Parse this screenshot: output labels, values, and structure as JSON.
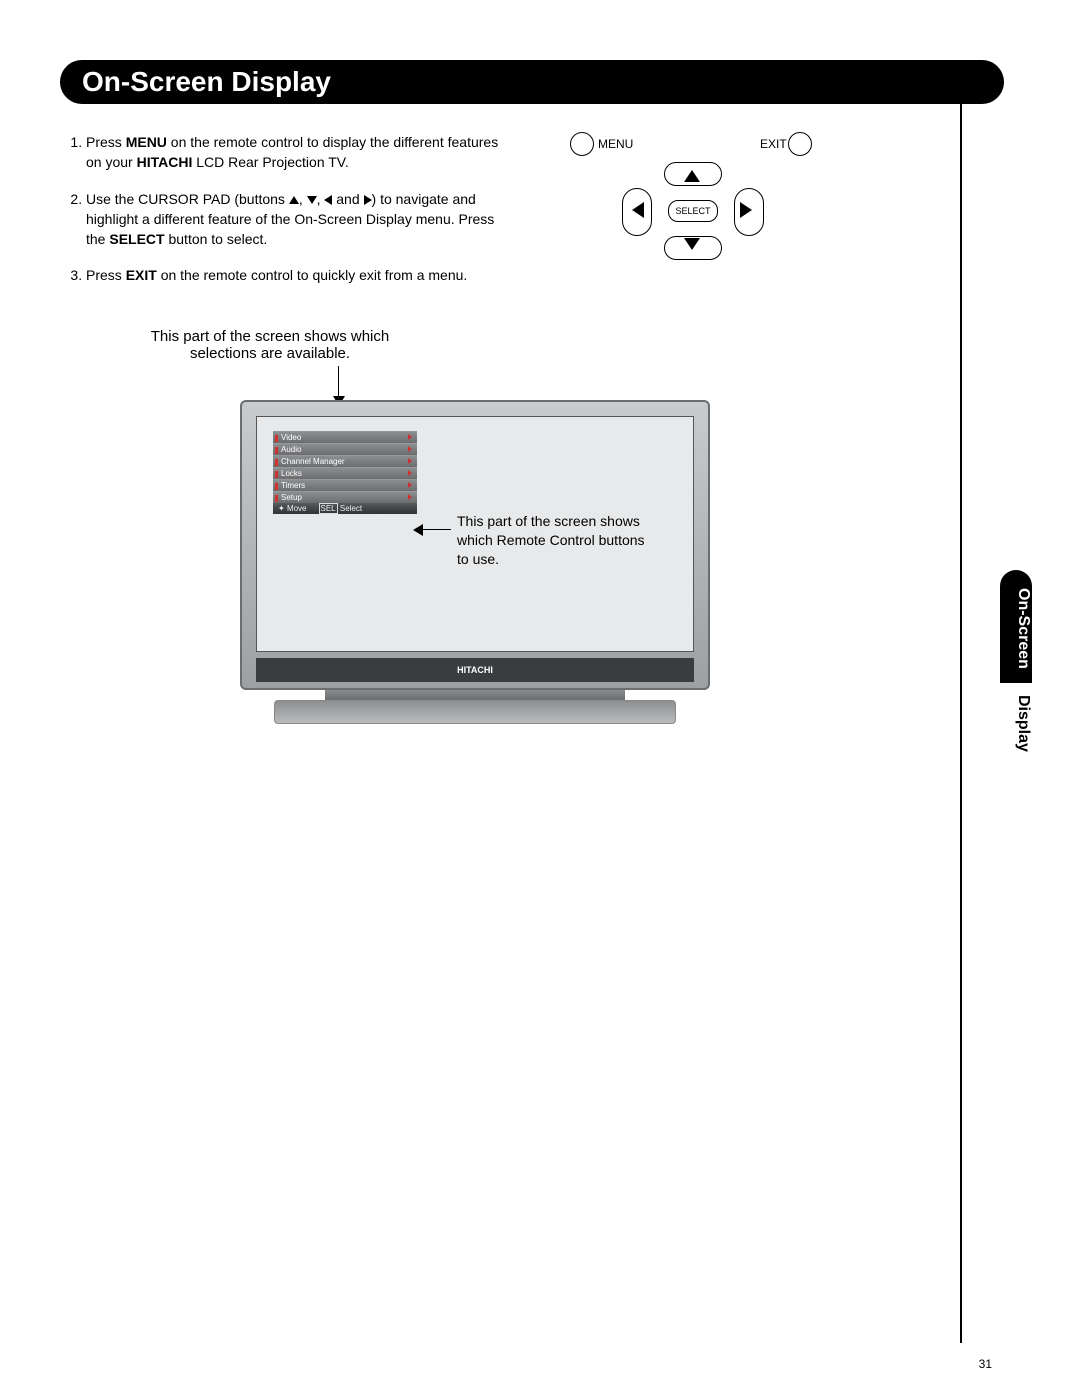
{
  "header": "On-Screen Display",
  "sideTabTop": "On-Screen",
  "sideTabBottom": "Display",
  "pageNumber": "31",
  "instructions": {
    "i1a": "Press ",
    "i1b": "MENU",
    "i1c": " on the remote control to display the different features on your ",
    "i1d": "HITACHI",
    "i1e": " LCD Rear Projection TV.",
    "i2a": "Use the CURSOR PAD  (buttons ",
    "i2b": ", ",
    "i2c": ", ",
    "i2d": " and ",
    "i2e": ") to navigate and highlight a different feature of the On-Screen Display menu. Press the ",
    "i2f": "SELECT",
    "i2g": " button to select.",
    "i3a": "Press ",
    "i3b": "EXIT",
    "i3c": " on the remote control to quickly exit from a menu."
  },
  "remote": {
    "menu": "MENU",
    "exit": "EXIT",
    "select": "SELECT"
  },
  "captionTop": "This part of the screen shows which selections are available.",
  "captionRight": "This part of the screen shows which Remote Control buttons to use.",
  "tvBrand": "HITACHI",
  "osd": {
    "items": [
      "Video",
      "Audio",
      "Channel Manager",
      "Locks",
      "Timers",
      "Setup"
    ],
    "helpMove": "Move",
    "helpSelectBox": "SEL",
    "helpSelect": "Select"
  }
}
